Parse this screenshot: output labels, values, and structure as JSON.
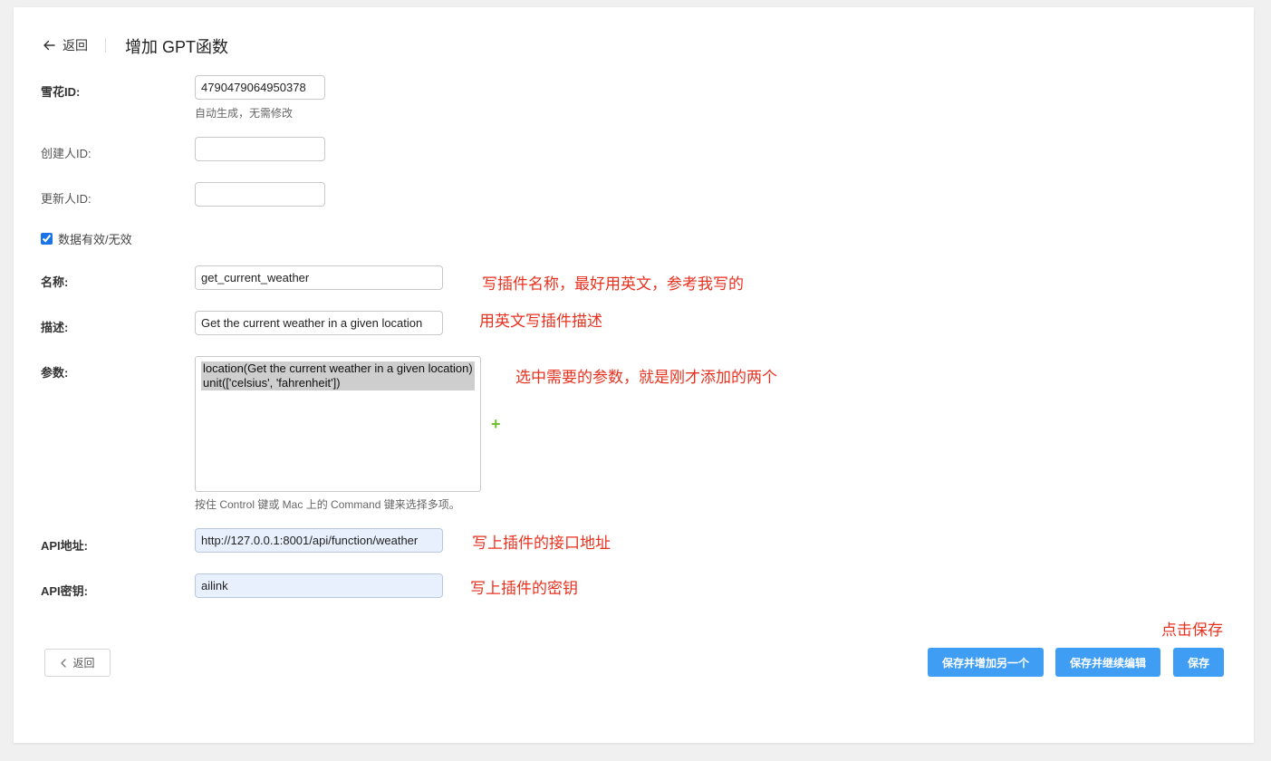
{
  "header": {
    "back_label": "返回",
    "title": "增加 GPT函数"
  },
  "form": {
    "snowflake_id": {
      "label": "雪花ID:",
      "value": "4790479064950378",
      "help": "自动生成，无需修改"
    },
    "creator_id": {
      "label": "创建人ID:",
      "value": ""
    },
    "updater_id": {
      "label": "更新人ID:",
      "value": ""
    },
    "active": {
      "label": "数据有效/无效",
      "checked": true
    },
    "name": {
      "label": "名称:",
      "value": "get_current_weather"
    },
    "description": {
      "label": "描述:",
      "value": "Get the current weather in a given location"
    },
    "parameters": {
      "label": "参数:",
      "options": [
        "location(Get the current weather in a given location)",
        "unit(['celsius', 'fahrenheit'])"
      ],
      "add_icon": "plus-icon",
      "help": "按住 Control 键或 Mac 上的 Command 键来选择多项。"
    },
    "api_url": {
      "label": "API地址:",
      "value": "http://127.0.0.1:8001/api/function/weather"
    },
    "api_key": {
      "label": "API密钥:",
      "value": "ailink"
    }
  },
  "annotations": {
    "name": "写插件名称，最好用英文，参考我写的",
    "description": "用英文写插件描述",
    "parameters": "选中需要的参数，就是刚才添加的两个",
    "api_url": "写上插件的接口地址",
    "api_key": "写上插件的密钥",
    "save": "点击保存"
  },
  "footer": {
    "back_label": "返回",
    "save_add_another": "保存并增加另一个",
    "save_continue": "保存并继续编辑",
    "save": "保存"
  },
  "colors": {
    "annotation": "#e8311f",
    "primary_button": "#3f9ef4",
    "add_icon": "#70bf2b"
  }
}
